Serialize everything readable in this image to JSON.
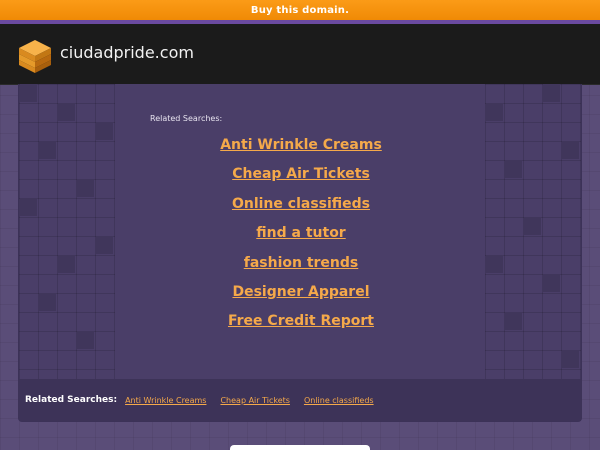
{
  "topbar": {
    "label": "Buy this domain."
  },
  "header": {
    "site_name": "ciudadpride.com",
    "logo_icon": "stacked-box-logo"
  },
  "main": {
    "related_label": "Related Searches:",
    "links": [
      "Anti Wrinkle Creams",
      "Cheap Air Tickets",
      "Online classifieds",
      "find a tutor",
      "fashion trends",
      "Designer Apparel",
      "Free Credit Report"
    ]
  },
  "bottom": {
    "label": "Related Searches:",
    "links": [
      "Anti Wrinkle Creams",
      "Cheap Air Tickets",
      "Online classifieds"
    ]
  },
  "colors": {
    "accent": "#f5a94a",
    "topbar": "#f08a05",
    "background": "#5a4d78",
    "panel": "#4a3e68",
    "header": "#1b1b1b"
  }
}
